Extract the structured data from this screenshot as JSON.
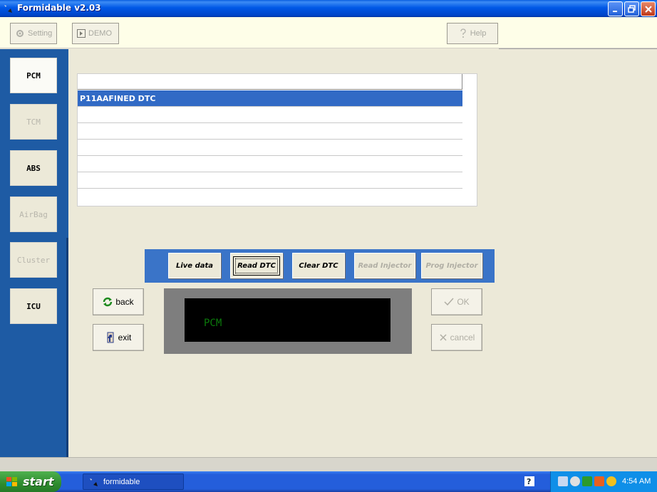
{
  "window": {
    "title": "Formidable v2.03"
  },
  "toolbar": {
    "setting_label": "Setting",
    "demo_label": "DEMO",
    "help_label": "Help"
  },
  "sidebar": {
    "items": [
      {
        "label": "PCM"
      },
      {
        "label": "TCM"
      },
      {
        "label": "ABS"
      },
      {
        "label": "AirBag"
      },
      {
        "label": "Cluster"
      },
      {
        "label": "ICU"
      }
    ]
  },
  "dtc_list": {
    "rows": [
      "P11AAFINED DTC",
      "",
      "",
      "",
      "",
      ""
    ]
  },
  "actions": {
    "live_data": "Live data",
    "read_dtc": "Read DTC",
    "clear_dtc": "Clear DTC",
    "read_injector": "Read Injector",
    "prog_injector": "Prog Injector"
  },
  "nav": {
    "back": "back",
    "exit": "exit"
  },
  "dialog": {
    "ok": "OK",
    "cancel": "cancel"
  },
  "display": {
    "text": "PCM"
  },
  "taskbar": {
    "start": "start",
    "task": "formidable",
    "clock": "4:54 AM"
  },
  "colors": {
    "accent": "#316AC5",
    "sidebar": "#1E5BA4",
    "display_text": "#0B7A0B"
  }
}
